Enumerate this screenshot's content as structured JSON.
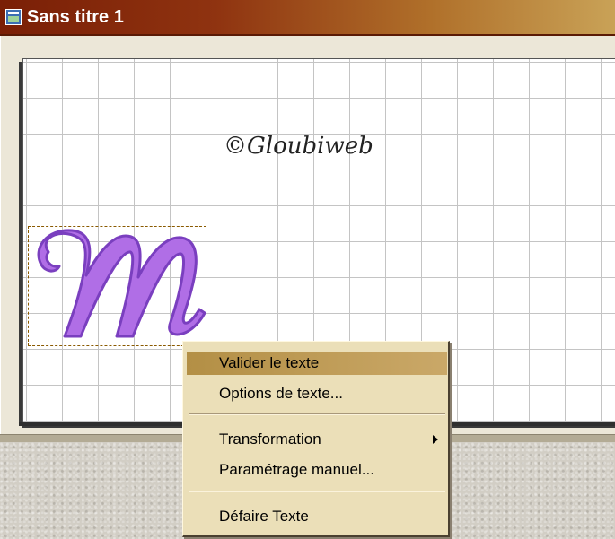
{
  "window": {
    "title": "Sans titre 1",
    "icon": "image-window-icon"
  },
  "canvas": {
    "watermark": "©Gloubiweb",
    "text_object": "M",
    "text_color": "#b06ee6",
    "text_outline_color": "#7a3fbf",
    "grid_color": "#c4c4c4"
  },
  "context_menu": {
    "items": [
      {
        "label": "Valider le texte",
        "highlighted": true
      },
      {
        "label": "Options de texte..."
      },
      {
        "label": "Transformation",
        "has_submenu": true
      },
      {
        "label": "Paramétrage manuel..."
      },
      {
        "label": "Défaire Texte"
      }
    ],
    "highlight_color": "#b38f45",
    "background_color": "#ebdfb8"
  }
}
